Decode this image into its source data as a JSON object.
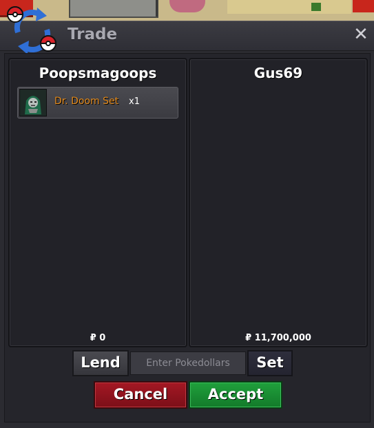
{
  "window": {
    "title": "Trade",
    "close_symbol": "✕"
  },
  "left_player": {
    "name": "Poopsmagoops",
    "items": [
      {
        "name": "Dr. Doom Set",
        "quantity": "x1",
        "icon": "dr-doom-avatar"
      }
    ],
    "money": "₽ 0"
  },
  "right_player": {
    "name": "Gus69",
    "items": [],
    "money": "₽ 11,700,000"
  },
  "controls": {
    "lend_label": "Lend",
    "pokedollar_placeholder": "Enter Pokedollars",
    "set_label": "Set",
    "cancel_label": "Cancel",
    "accept_label": "Accept"
  },
  "colors": {
    "cancel": "#a41824",
    "accept": "#20a03c",
    "item_name": "#e38a1c"
  }
}
